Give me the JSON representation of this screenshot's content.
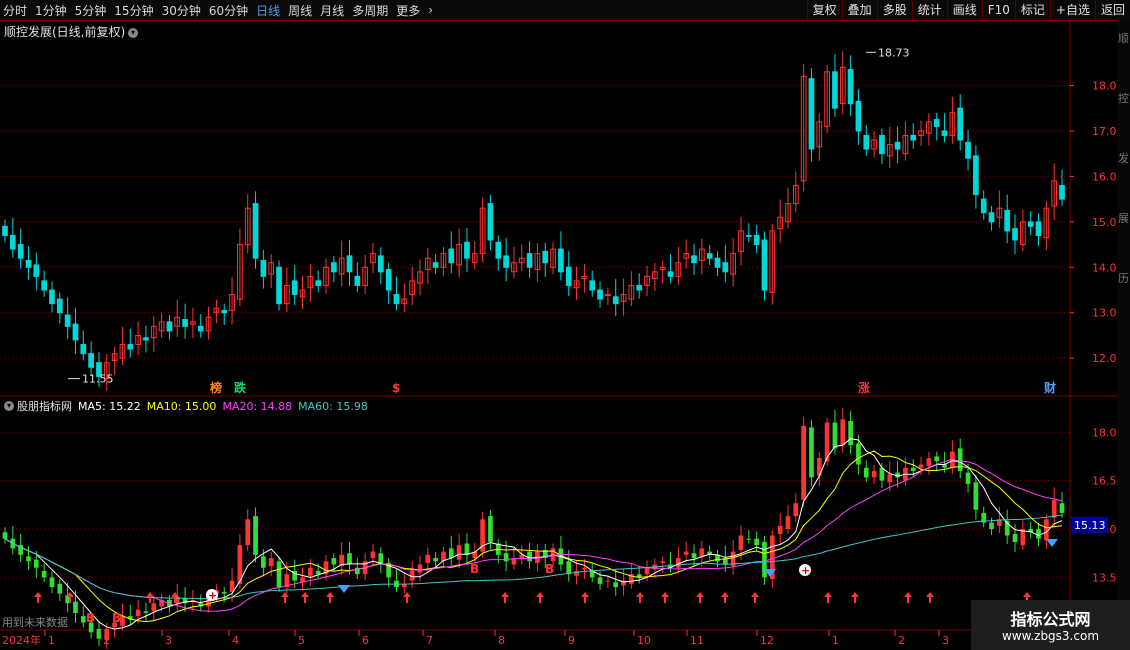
{
  "toolbar": {
    "periods": [
      "分时",
      "1分钟",
      "5分钟",
      "15分钟",
      "30分钟",
      "60分钟",
      "日线",
      "周线",
      "月线",
      "多周期",
      "更多"
    ],
    "selected": "日线",
    "more_icon": "chevron-right-icon",
    "right_buttons": [
      "复权",
      "叠加",
      "多股",
      "统计",
      "画线",
      "F10",
      "标记",
      "+自选",
      "返回"
    ]
  },
  "main_chart": {
    "title": "顺控发展(日线,前复权)",
    "title_icon": "chevron-down-icon",
    "axis_labels": [
      "18.00",
      "17.00",
      "16.00",
      "15.00",
      "14.00",
      "13.00",
      "12.00"
    ],
    "high_label": "18.73",
    "low_label": "11.55",
    "event_tags": [
      {
        "text": "榜",
        "color": "#ff8c00"
      },
      {
        "text": "跌",
        "color": "#00e060"
      },
      {
        "text": "$",
        "color": "#ff3333"
      },
      {
        "text": "涨",
        "color": "#ff3333"
      },
      {
        "text": "财",
        "color": "#4aa0ff"
      }
    ]
  },
  "sub_chart": {
    "title": "股朋指标网",
    "title_icon": "chevron-down-icon",
    "ma": [
      {
        "label": "MA5: 15.22",
        "color": "#ffffff"
      },
      {
        "label": "MA10: 15.00",
        "color": "#ffff00"
      },
      {
        "label": "MA20: 14.88",
        "color": "#ff40ff"
      },
      {
        "label": "MA60: 15.98",
        "color": "#40c8c8"
      }
    ],
    "axis_labels": [
      "18.00",
      "16.50",
      "15.00",
      "13.50"
    ],
    "current_price": "15.13",
    "footer_note": "用到未来数据",
    "signal_letters": [
      "B",
      "B",
      "B",
      "B",
      "B"
    ]
  },
  "x_axis": {
    "year_label": "2024年",
    "months": [
      "1",
      "2",
      "3",
      "4",
      "5",
      "6",
      "7",
      "8",
      "9",
      "10",
      "11",
      "12",
      "1",
      "2",
      "3"
    ]
  },
  "right_edge_text": [
    "顺",
    "控",
    "发",
    "展",
    "历"
  ],
  "watermark": {
    "line1": "指标公式网",
    "line2": "www.zbgs3.com"
  },
  "colors": {
    "up": "#ff3333",
    "down": "#00d8d8",
    "grid": "#7a0000",
    "axis": "#ff3333"
  },
  "chart_data": {
    "type": "candlestick",
    "price_range": [
      11.3,
      19.0
    ],
    "closes": [
      14.7,
      14.4,
      14.2,
      14.0,
      13.8,
      13.5,
      13.2,
      13.0,
      12.7,
      12.4,
      12.1,
      11.8,
      11.6,
      11.9,
      12.1,
      12.3,
      12.2,
      12.5,
      12.4,
      12.7,
      12.8,
      12.6,
      12.9,
      12.7,
      12.8,
      12.6,
      12.9,
      13.1,
      13.0,
      13.4,
      14.5,
      15.3,
      14.2,
      13.8,
      14.1,
      13.2,
      13.6,
      13.4,
      13.5,
      13.8,
      13.6,
      14.0,
      13.9,
      14.2,
      13.9,
      13.6,
      14.0,
      14.3,
      13.9,
      13.5,
      13.2,
      13.3,
      13.7,
      13.9,
      14.2,
      14.0,
      14.3,
      14.1,
      14.5,
      14.2,
      14.3,
      15.3,
      14.6,
      14.2,
      14.0,
      14.1,
      14.2,
      14.0,
      14.3,
      14.1,
      14.4,
      13.9,
      13.6,
      13.7,
      13.8,
      13.5,
      13.3,
      13.4,
      13.2,
      13.4,
      13.6,
      13.5,
      13.8,
      13.9,
      14.0,
      13.8,
      14.1,
      14.3,
      14.1,
      14.4,
      14.2,
      14.0,
      13.9,
      14.3,
      14.8,
      14.7,
      14.5,
      13.5,
      14.8,
      15.1,
      15.4,
      15.8,
      18.2,
      16.6,
      17.2,
      18.3,
      17.5,
      18.4,
      17.6,
      17.0,
      16.6,
      16.8,
      16.5,
      16.7,
      16.6,
      16.9,
      16.8,
      17.0,
      17.2,
      17.1,
      16.9,
      17.4,
      16.8,
      16.4,
      15.6,
      15.2,
      15.0,
      15.3,
      14.8,
      14.6,
      15.0,
      14.9,
      14.7,
      15.3,
      15.9,
      15.5
    ]
  }
}
